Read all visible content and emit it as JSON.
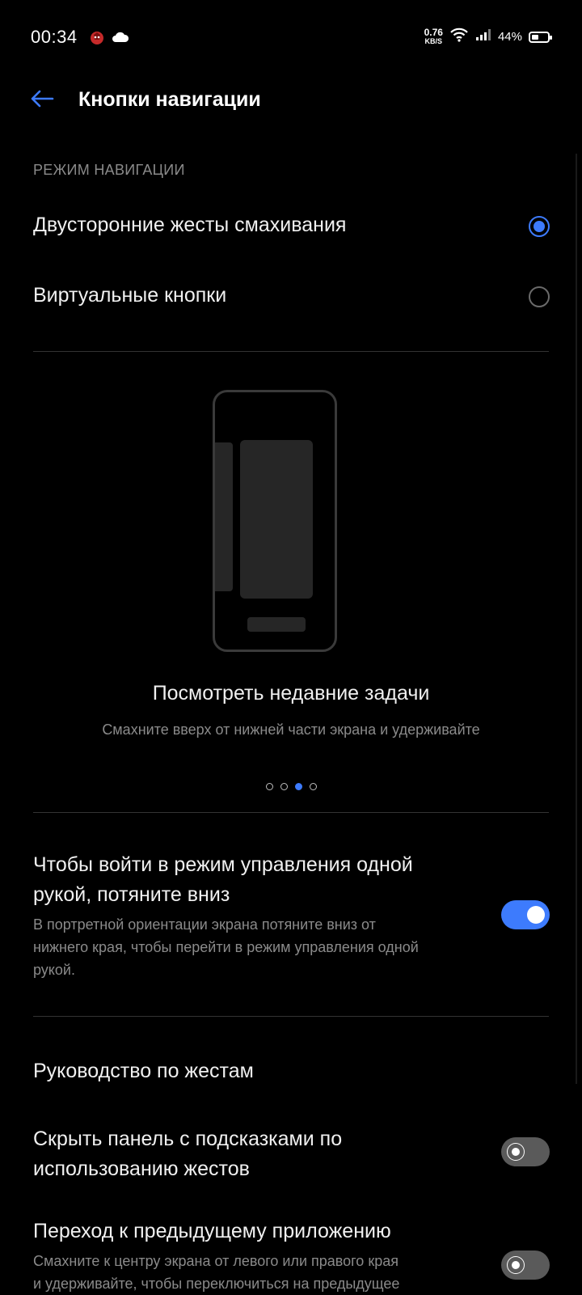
{
  "status_bar": {
    "time": "00:34",
    "netspeed_value": "0.76",
    "netspeed_unit": "KB/S",
    "battery_percent": "44%",
    "battery_level": 0.44,
    "icons": [
      "app-notification-icon",
      "cloud-icon",
      "wifi-icon",
      "signal-icon",
      "battery-icon"
    ]
  },
  "app_bar": {
    "title": "Кнопки навигации",
    "back_icon": "arrow-left-icon"
  },
  "navigation_mode": {
    "header": "РЕЖИМ НАВИГАЦИИ",
    "options": [
      {
        "label": "Двусторонние жесты смахивания",
        "selected": true
      },
      {
        "label": "Виртуальные кнопки",
        "selected": false
      }
    ]
  },
  "carousel": {
    "title": "Посмотреть недавние задачи",
    "description": "Смахните вверх от нижней части экрана и удерживайте",
    "page_count": 4,
    "active_page": 3
  },
  "settings": {
    "one_hand": {
      "title_line1": "Чтобы войти в режим управления одной",
      "title_line2": "рукой, потяните вниз",
      "desc_line1": "В портретной ориентации экрана потяните вниз от",
      "desc_line2": "нижнего края, чтобы перейти в режим управления одной",
      "desc_line3": "рукой.",
      "enabled": true
    },
    "gesture_guide": {
      "title": "Руководство по жестам"
    },
    "hide_hint_bar": {
      "title_line1": "Скрыть панель с подсказками по",
      "title_line2": "использованию жестов",
      "enabled": false
    },
    "previous_app": {
      "title": "Переход к предыдущему приложению",
      "desc_line1": "Смахните к центру экрана от левого или правого края",
      "desc_line2": "и удерживайте, чтобы переключиться на предыдущее",
      "enabled": false
    }
  },
  "colors": {
    "accent": "#3d7bfd",
    "background": "#000000",
    "secondary_text": "#8a8a8a"
  }
}
